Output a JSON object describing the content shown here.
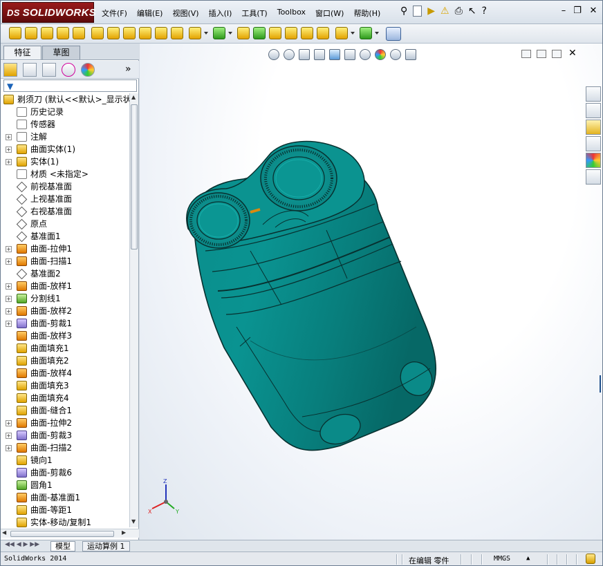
{
  "app": {
    "brand": "SOLIDWORKS",
    "brand_prefix": "DS"
  },
  "menu": [
    "文件(F)",
    "编辑(E)",
    "视图(V)",
    "插入(I)",
    "工具(T)",
    "Toolbox",
    "窗口(W)",
    "帮助(H)"
  ],
  "panel": {
    "tabs": [
      "特征",
      "草图"
    ],
    "active_tab": "草图",
    "collapse_glyph": "»",
    "filter_icon": "filter-icon"
  },
  "tree": [
    {
      "label": "剃须刀  (默认<<默认>_显示状",
      "icon": "part-icon",
      "exp": ""
    },
    {
      "label": "历史记录",
      "icon": "history-icon",
      "exp": ""
    },
    {
      "label": "传感器",
      "icon": "sensor-icon",
      "exp": ""
    },
    {
      "label": "注解",
      "icon": "annotation-icon",
      "exp": "+"
    },
    {
      "label": "曲面实体(1)",
      "icon": "surface-body-icon",
      "exp": "+"
    },
    {
      "label": "实体(1)",
      "icon": "solid-body-icon",
      "exp": "+"
    },
    {
      "label": "材质 <未指定>",
      "icon": "material-icon",
      "exp": ""
    },
    {
      "label": "前视基准面",
      "icon": "plane-icon",
      "exp": ""
    },
    {
      "label": "上视基准面",
      "icon": "plane-icon",
      "exp": ""
    },
    {
      "label": "右视基准面",
      "icon": "plane-icon",
      "exp": ""
    },
    {
      "label": "原点",
      "icon": "origin-icon",
      "exp": ""
    },
    {
      "label": "基准面1",
      "icon": "plane-icon",
      "exp": ""
    },
    {
      "label": "曲面-拉伸1",
      "icon": "surface-extrude-icon",
      "exp": "+"
    },
    {
      "label": "曲面-扫描1",
      "icon": "surface-sweep-icon",
      "exp": "+"
    },
    {
      "label": "基准面2",
      "icon": "plane-icon",
      "exp": ""
    },
    {
      "label": "曲面-放样1",
      "icon": "surface-loft-icon",
      "exp": "+"
    },
    {
      "label": "分割线1",
      "icon": "split-line-icon",
      "exp": "+"
    },
    {
      "label": "曲面-放样2",
      "icon": "surface-loft-icon",
      "exp": "+"
    },
    {
      "label": "曲面-剪裁1",
      "icon": "surface-trim-icon",
      "exp": "+"
    },
    {
      "label": "曲面-放样3",
      "icon": "surface-loft-icon",
      "exp": ""
    },
    {
      "label": "曲面填充1",
      "icon": "surface-fill-icon",
      "exp": ""
    },
    {
      "label": "曲面填充2",
      "icon": "surface-fill-icon",
      "exp": ""
    },
    {
      "label": "曲面-放样4",
      "icon": "surface-loft-icon",
      "exp": ""
    },
    {
      "label": "曲面填充3",
      "icon": "surface-fill-icon",
      "exp": ""
    },
    {
      "label": "曲面填充4",
      "icon": "surface-fill-icon",
      "exp": ""
    },
    {
      "label": "曲面-缝合1",
      "icon": "surface-knit-icon",
      "exp": ""
    },
    {
      "label": "曲面-拉伸2",
      "icon": "surface-extrude-icon",
      "exp": "+"
    },
    {
      "label": "曲面-剪裁3",
      "icon": "surface-trim-icon",
      "exp": "+"
    },
    {
      "label": "曲面-扫描2",
      "icon": "surface-sweep-icon",
      "exp": "+"
    },
    {
      "label": "镜向1",
      "icon": "mirror-icon",
      "exp": ""
    },
    {
      "label": "曲面-剪裁6",
      "icon": "surface-trim-icon",
      "exp": ""
    },
    {
      "label": "圆角1",
      "icon": "fillet-icon",
      "exp": ""
    },
    {
      "label": "曲面-基准面1",
      "icon": "planar-surface-icon",
      "exp": ""
    },
    {
      "label": "曲面-等距1",
      "icon": "surface-offset-icon",
      "exp": ""
    },
    {
      "label": "实体-移动/复制1",
      "icon": "move-copy-icon",
      "exp": ""
    }
  ],
  "bottom_tabs": [
    "模型",
    "运动算例 1"
  ],
  "status": {
    "left": "SolidWorks 2014",
    "mode": "在编辑 零件",
    "units": "MMGS"
  },
  "triad": {
    "x": "X",
    "y": "Y",
    "z": "Z"
  },
  "colors": {
    "model": "#0a8a88",
    "model_edge": "#08302f",
    "brand": "#8b1515"
  }
}
